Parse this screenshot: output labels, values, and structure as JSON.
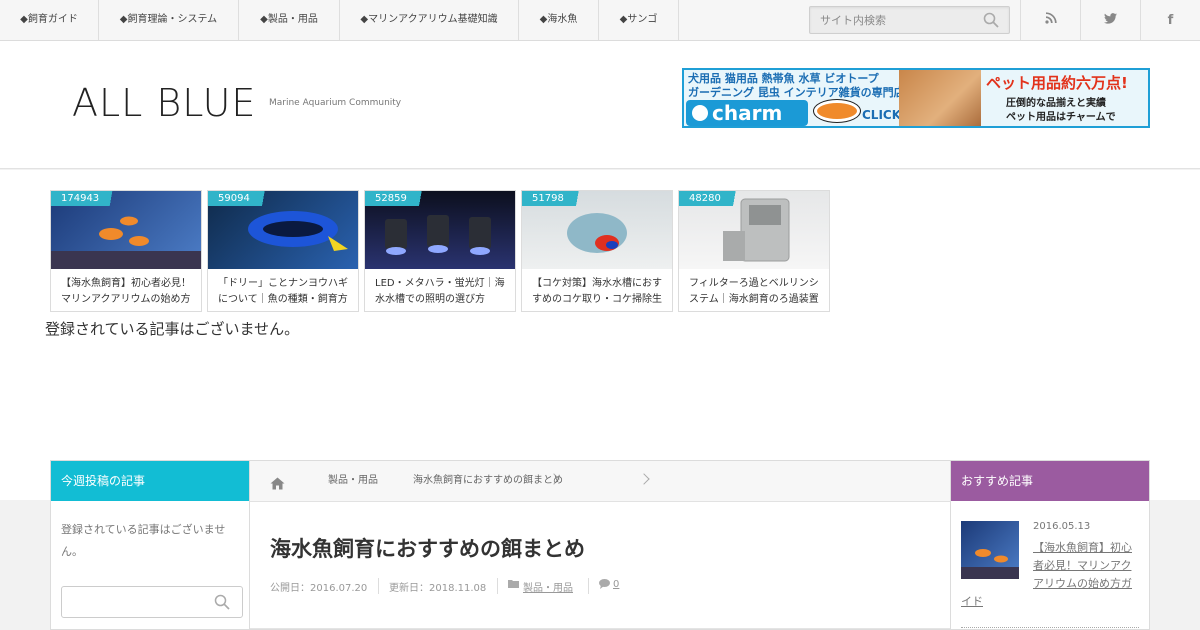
{
  "nav": {
    "items": [
      {
        "label": "◆飼育ガイド"
      },
      {
        "label": "◆飼育理論・システム"
      },
      {
        "label": "◆製品・用品"
      },
      {
        "label": "◆マリンアクアリウム基礎知識"
      },
      {
        "label": "◆海水魚"
      },
      {
        "label": "◆サンゴ"
      }
    ],
    "search_placeholder": "サイト内検索",
    "social": [
      {
        "icon": "rss-icon"
      },
      {
        "icon": "twitter-icon"
      },
      {
        "icon": "facebook-icon",
        "glyph": "f"
      }
    ]
  },
  "header": {
    "title": "ALL BLUE",
    "description": "Marine Aquarium Community",
    "banner": {
      "line1": "犬用品 猫用品 熱帯魚 水草 ビオトープ",
      "line2": "ガーデニング 昆虫 インテリア雑貨の専門店",
      "logo": "charm",
      "click": "CLICK!",
      "promo1": "ペット用品約六万点!",
      "promo2": "圧倒的な品揃えと実績",
      "promo3": "ペット用品はチャームで"
    }
  },
  "popular": [
    {
      "count": "174943",
      "title": "【海水魚飼育】初心者必見！マリンアクアリウムの始め方",
      "colors": [
        "#1c3a78",
        "#4d7ec8"
      ]
    },
    {
      "count": "59094",
      "title": "「ドリー」ことナンヨウハギについて｜魚の種類・飼育方",
      "colors": [
        "#0f2a4a",
        "#2a62b0"
      ]
    },
    {
      "count": "52859",
      "title": "LED・メタハラ・蛍光灯｜海水水槽での照明の選び方",
      "colors": [
        "#0c0f1e",
        "#4a5bb8"
      ]
    },
    {
      "count": "51798",
      "title": "【コケ対策】海水水槽におすすめのコケ取り・コケ掃除生",
      "colors": [
        "#b9c3c8",
        "#e6e9ea"
      ]
    },
    {
      "count": "48280",
      "title": "フィルターろ過とベルリンシステム｜海水飼育のろ過装置",
      "colors": [
        "#d7d9da",
        "#f1f1f1"
      ]
    }
  ],
  "main_notice": "登録されている記事はございません。",
  "weekly": {
    "header": "今週投稿の記事",
    "message": "登録されている記事はございません。"
  },
  "breadcrumb": {
    "home_icon": "home-icon",
    "items": [
      "製品・用品",
      "海水魚飼育におすすめの餌まとめ"
    ]
  },
  "post": {
    "title": "海水魚飼育におすすめの餌まとめ",
    "published": "公開日：2016.07.20",
    "updated": "更新日：2018.11.08",
    "category": "製品・用品",
    "comments": "0"
  },
  "recommended": {
    "header": "おすすめ記事",
    "items": [
      {
        "date": "2016.05.13",
        "title": "【海水魚飼育】初心者必見！マリンアクアリウムの始め方ガイド"
      }
    ]
  },
  "colors": {
    "accent_cyan": "#12bdd4",
    "accent_purple": "#9b5ba0",
    "count_badge": "#31b4c9"
  }
}
